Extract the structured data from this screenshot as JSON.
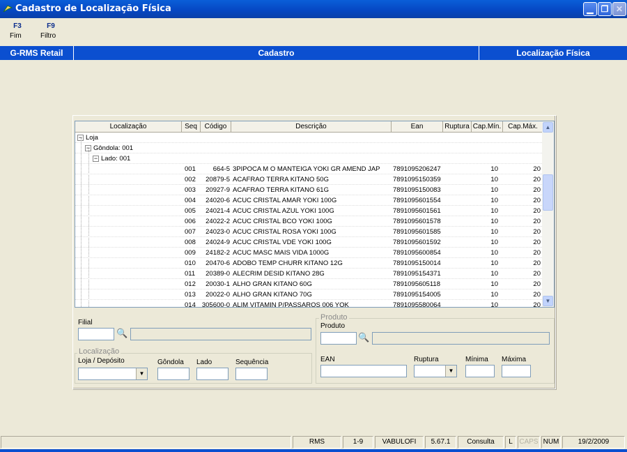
{
  "window": {
    "title": "Cadastro de Localização Física"
  },
  "toolbar": {
    "items": [
      {
        "key": "F3",
        "label": "Fim"
      },
      {
        "key": "F9",
        "label": "Filtro"
      }
    ]
  },
  "header": {
    "left": "G-RMS Retail",
    "center": "Cadastro",
    "right": "Localização Física"
  },
  "grid": {
    "columns": [
      "Localização",
      "Seq",
      "Código",
      "Descrição",
      "Ean",
      "Ruptura",
      "Cap.Mín.",
      "Cap.Máx."
    ],
    "tree": {
      "loja": "Loja",
      "gondola": "Gôndola: 001",
      "lado": "Lado: 001"
    },
    "rows": [
      {
        "seq": "001",
        "codigo": "664-5",
        "descricao": "3PIPOCA M O MANTEIGA YOKI GR AMEND JAP",
        "ean": "7891095206247",
        "ruptura": "",
        "min": "10",
        "max": "20"
      },
      {
        "seq": "002",
        "codigo": "20879-5",
        "descricao": "ACAFRAO TERRA KITANO 50G",
        "ean": "7891095150359",
        "ruptura": "",
        "min": "10",
        "max": "20"
      },
      {
        "seq": "003",
        "codigo": "20927-9",
        "descricao": "ACAFRAO TERRA KITANO 61G",
        "ean": "7891095150083",
        "ruptura": "",
        "min": "10",
        "max": "20"
      },
      {
        "seq": "004",
        "codigo": "24020-6",
        "descricao": "ACUC CRISTAL AMAR YOKI 100G",
        "ean": "7891095601554",
        "ruptura": "",
        "min": "10",
        "max": "20"
      },
      {
        "seq": "005",
        "codigo": "24021-4",
        "descricao": "ACUC CRISTAL AZUL YOKI 100G",
        "ean": "7891095601561",
        "ruptura": "",
        "min": "10",
        "max": "20"
      },
      {
        "seq": "006",
        "codigo": "24022-2",
        "descricao": "ACUC CRISTAL BCO YOKI 100G",
        "ean": "7891095601578",
        "ruptura": "",
        "min": "10",
        "max": "20"
      },
      {
        "seq": "007",
        "codigo": "24023-0",
        "descricao": "ACUC CRISTAL ROSA YOKI 100G",
        "ean": "7891095601585",
        "ruptura": "",
        "min": "10",
        "max": "20"
      },
      {
        "seq": "008",
        "codigo": "24024-9",
        "descricao": "ACUC CRISTAL VDE YOKI 100G",
        "ean": "7891095601592",
        "ruptura": "",
        "min": "10",
        "max": "20"
      },
      {
        "seq": "009",
        "codigo": "24182-2",
        "descricao": "ACUC MASC MAIS VIDA 1000G",
        "ean": "7891095600854",
        "ruptura": "",
        "min": "10",
        "max": "20"
      },
      {
        "seq": "010",
        "codigo": "20470-6",
        "descricao": "ADOBO TEMP CHURR KITANO 12G",
        "ean": "7891095150014",
        "ruptura": "",
        "min": "10",
        "max": "20"
      },
      {
        "seq": "011",
        "codigo": "20389-0",
        "descricao": "ALECRIM DESID KITANO 28G",
        "ean": "7891095154371",
        "ruptura": "",
        "min": "10",
        "max": "20"
      },
      {
        "seq": "012",
        "codigo": "20030-1",
        "descricao": "ALHO GRAN KITANO 60G",
        "ean": "7891095605118",
        "ruptura": "",
        "min": "10",
        "max": "20"
      },
      {
        "seq": "013",
        "codigo": "20022-0",
        "descricao": "ALHO GRAN KITANO 70G",
        "ean": "7891095154005",
        "ruptura": "",
        "min": "10",
        "max": "20"
      },
      {
        "seq": "014",
        "codigo": "305600-0",
        "descricao": "ALIM VITAMIN P/PASSAROS 006 YOK",
        "ean": "7891095580064",
        "ruptura": "",
        "min": "10",
        "max": "20"
      }
    ]
  },
  "form": {
    "filial_label": "Filial",
    "localizacao_group": "Localização",
    "loja_label": "Loja / Depósito",
    "gondola_label": "Gôndola",
    "lado_label": "Lado",
    "sequencia_label": "Sequência",
    "produto_group": "Produto",
    "produto_label": "Produto",
    "ean_label": "EAN",
    "ruptura_label": "Ruptura",
    "minima_label": "Mínima",
    "maxima_label": "Máxima"
  },
  "status": {
    "app": "RMS",
    "range": "1-9",
    "user": "VABULOFI",
    "version": "5.67.1",
    "mode": "Consulta",
    "l": "L",
    "caps": "CAPS",
    "num": "NUM",
    "date": "19/2/2009"
  },
  "colors": {
    "titlebar": "#0648C4",
    "header": "#0B4FD0",
    "background": "#ECE9D8"
  }
}
